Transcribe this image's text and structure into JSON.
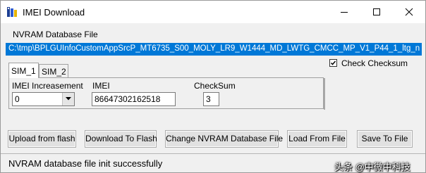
{
  "window": {
    "title": "IMEI Download",
    "icon": "sim-chip-icon"
  },
  "nvram": {
    "label": "NVRAM Database File",
    "path": "C:\\tmp\\BPLGUInfoCustomAppSrcP_MT6735_S00_MOLY_LR9_W1444_MD_LWTG_CMCC_MP_V1_P44_1_ltg_n"
  },
  "check_checksum": {
    "label": "Check Checksum",
    "checked": true
  },
  "tabs": [
    {
      "label": "SIM_1",
      "active": true
    },
    {
      "label": "SIM_2",
      "active": false
    }
  ],
  "sim_panel": {
    "increasement_label": "IMEI Increasement",
    "increasement_value": "0",
    "imei_label": "IMEI",
    "imei_value": "86647302162518",
    "checksum_label": "CheckSum",
    "checksum_value": "3"
  },
  "buttons": {
    "upload": "Upload from flash",
    "download": "Download To Flash",
    "change": "Change NVRAM Database File",
    "load": "Load From File",
    "save": "Save To File"
  },
  "status": "NVRAM database file init successfully",
  "watermark": "头条 @中微中科技",
  "colors": {
    "selection": "#0078d7",
    "face": "#f0f0f0"
  }
}
